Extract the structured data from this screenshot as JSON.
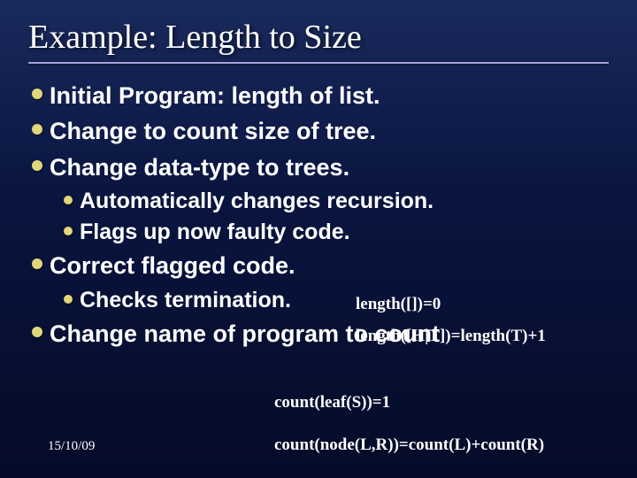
{
  "title": "Example: Length to Size",
  "bullets": {
    "b1": "Initial Program: length of list.",
    "b2": "Change to count size of tree.",
    "b3": "Change data-type to trees.",
    "b3a": "Automatically changes recursion.",
    "b3b": "Flags up now faulty code.",
    "b4": "Correct flagged code.",
    "b4a": "Checks termination.",
    "b5": "Change name of program to count"
  },
  "code": {
    "length_base": "length([])=0",
    "length_rec": "length([H|T])=length(T)+1",
    "count_base": "count(leaf(S))=1",
    "count_rec": "count(node(L,R))=count(L)+count(R)"
  },
  "date": "15/10/09"
}
